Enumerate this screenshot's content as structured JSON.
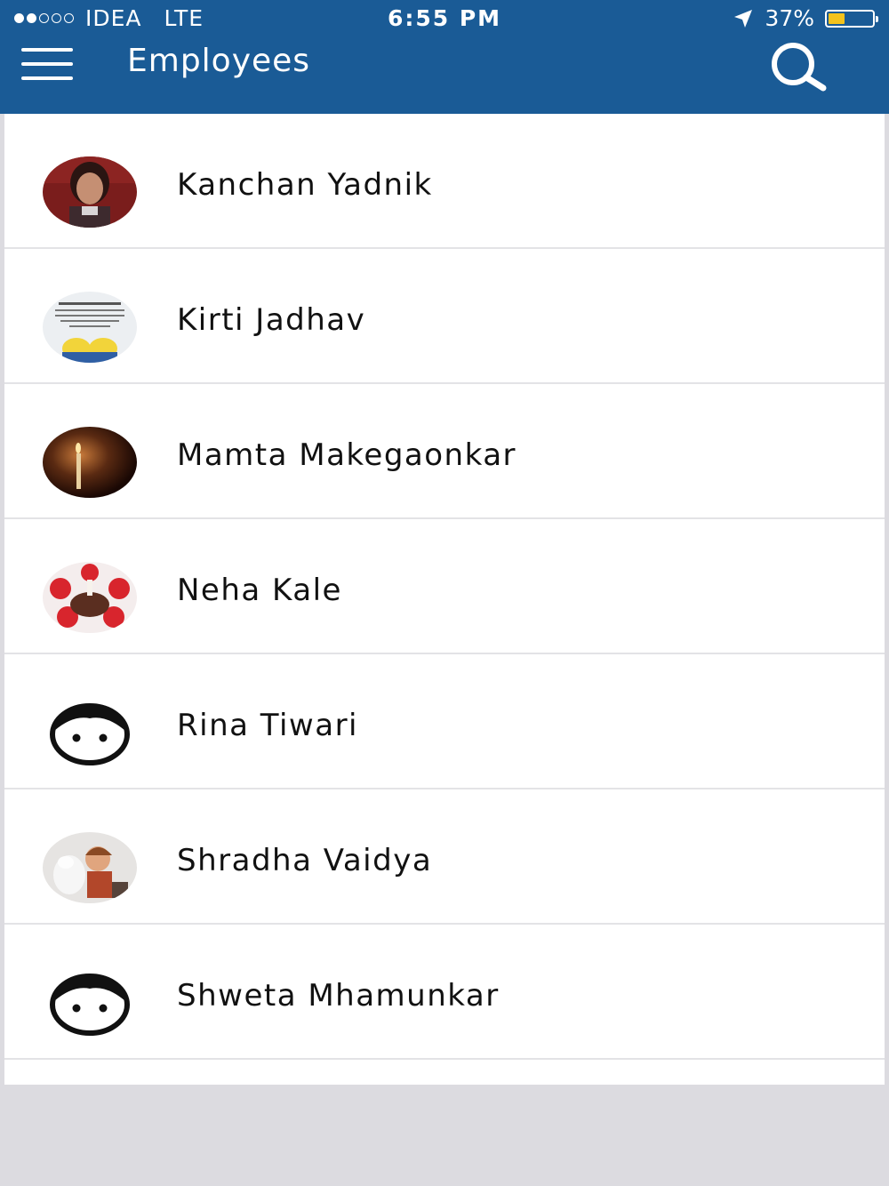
{
  "status_bar": {
    "carrier": "IDEA",
    "network": "LTE",
    "time": "6:55 PM",
    "battery_text": "37%",
    "battery_level": 0.37,
    "signal_bars": 2,
    "signal_total": 5
  },
  "header": {
    "title": "Employees",
    "menu_icon": "hamburger-menu-icon",
    "search_icon": "search-icon",
    "background_color": "#1a5b96"
  },
  "employees": [
    {
      "name": "Kanchan Yadnik",
      "avatar": "portrait-photo"
    },
    {
      "name": "Kirti Jadhav",
      "avatar": "friends-quote-image"
    },
    {
      "name": "Mamta Makegaonkar",
      "avatar": "candle-photo"
    },
    {
      "name": "Neha Kale",
      "avatar": "cake-photo"
    },
    {
      "name": "Rina Tiwari",
      "avatar": "default-face-icon"
    },
    {
      "name": "Shradha Vaidya",
      "avatar": "cartoon-photo"
    },
    {
      "name": "Shweta Mhamunkar",
      "avatar": "default-face-icon"
    }
  ]
}
